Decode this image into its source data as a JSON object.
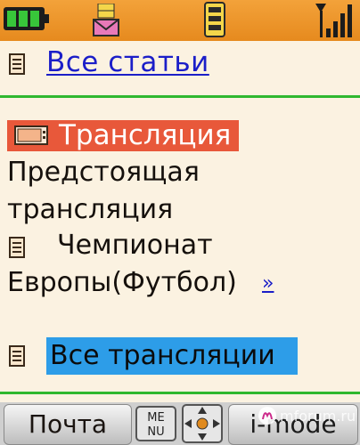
{
  "status_bar": {
    "battery_icon": "battery-full-icon",
    "message_icon": "envelope-icon",
    "memory_icon": "sd-card-icon",
    "signal_icon": "signal-strength-icon"
  },
  "links": {
    "all_articles": "Все статьи",
    "more": "»",
    "all_broadcasts": "Все трансляции"
  },
  "section": {
    "title": "Трансляция",
    "line1": "Предстоящая",
    "line2": "трансляция",
    "item_line1": "Чемпионат",
    "item_line2": "Европы(Футбол)"
  },
  "softkeys": {
    "left": "Почта",
    "menu": "MENU",
    "right": "i-mode"
  },
  "watermark": "mforum.ru",
  "colors": {
    "status_bar": "#e68a1e",
    "link": "#1b1ec8",
    "divider": "#2fb82f",
    "section_header": "#e8583a",
    "highlight": "#2d9de8",
    "background": "#fbf2e1"
  }
}
